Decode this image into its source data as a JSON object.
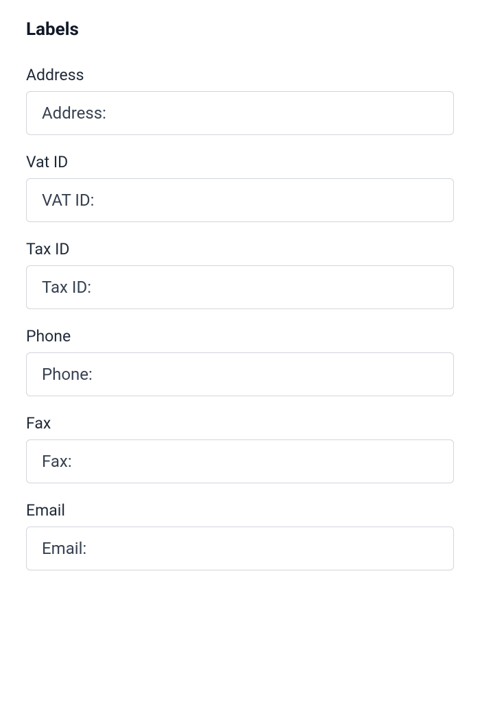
{
  "section": {
    "title": "Labels"
  },
  "fields": {
    "address": {
      "label": "Address",
      "value": "Address:"
    },
    "vat_id": {
      "label": "Vat ID",
      "value": "VAT ID:"
    },
    "tax_id": {
      "label": "Tax ID",
      "value": "Tax ID:"
    },
    "phone": {
      "label": "Phone",
      "value": "Phone:"
    },
    "fax": {
      "label": "Fax",
      "value": "Fax:"
    },
    "email": {
      "label": "Email",
      "value": "Email:"
    }
  }
}
